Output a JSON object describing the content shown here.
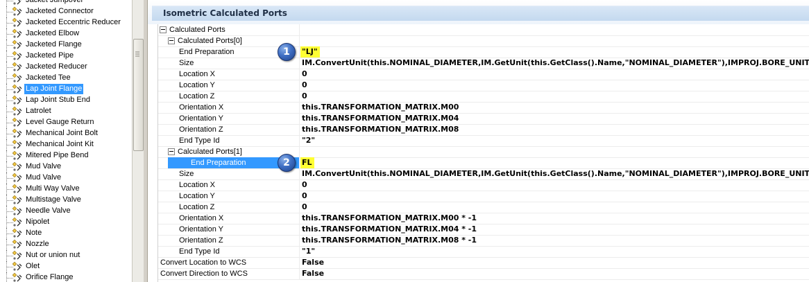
{
  "tree": {
    "items": [
      {
        "label": "Jacket Jumpover"
      },
      {
        "label": "Jacketed Connector"
      },
      {
        "label": "Jacketed Eccentric Reducer"
      },
      {
        "label": "Jacketed Elbow"
      },
      {
        "label": "Jacketed Flange"
      },
      {
        "label": "Jacketed Pipe"
      },
      {
        "label": "Jacketed Reducer"
      },
      {
        "label": "Jacketed Tee"
      },
      {
        "label": "Lap Joint Flange",
        "selected": true
      },
      {
        "label": "Lap Joint Stub End"
      },
      {
        "label": "Latrolet"
      },
      {
        "label": "Level Gauge Return"
      },
      {
        "label": "Mechanical Joint Bolt"
      },
      {
        "label": "Mechanical Joint Kit"
      },
      {
        "label": "Mitered Pipe Bend"
      },
      {
        "label": "Mud Valve"
      },
      {
        "label": "Mud Valve"
      },
      {
        "label": "Multi Way Valve"
      },
      {
        "label": "Multistage Valve"
      },
      {
        "label": "Needle Valve"
      },
      {
        "label": "Nipolet"
      },
      {
        "label": "Note"
      },
      {
        "label": "Nozzle"
      },
      {
        "label": "Nut or union nut"
      },
      {
        "label": "Olet"
      },
      {
        "label": "Orifice Flange"
      }
    ],
    "item_icon": "component-node-icon"
  },
  "panel": {
    "title": "Isometric Calculated Ports"
  },
  "grid": {
    "rows": [
      {
        "name": "Calculated Ports",
        "value": "",
        "level": 0,
        "expander": true
      },
      {
        "name": "Calculated Ports[0]",
        "value": "",
        "level": 1,
        "expander": true
      },
      {
        "name": "End Preparation",
        "value": "\"LJ\"",
        "level": 2,
        "highlight_value": true,
        "callout": "1"
      },
      {
        "name": "Size",
        "value": "IM.ConvertUnit(this.NOMINAL_DIAMETER,IM.GetUnit(this.GetClass().Name,\"NOMINAL_DIAMETER\"),IMPROJ.BORE_UNIT)",
        "level": 2
      },
      {
        "name": "Location X",
        "value": "0",
        "level": 2
      },
      {
        "name": "Location Y",
        "value": "0",
        "level": 2
      },
      {
        "name": "Location Z",
        "value": "0",
        "level": 2
      },
      {
        "name": "Orientation X",
        "value": "this.TRANSFORMATION_MATRIX.M00",
        "level": 2
      },
      {
        "name": "Orientation Y",
        "value": "this.TRANSFORMATION_MATRIX.M04",
        "level": 2
      },
      {
        "name": "Orientation Z",
        "value": "this.TRANSFORMATION_MATRIX.M08",
        "level": 2
      },
      {
        "name": "End Type Id",
        "value": "\"2\"",
        "level": 2
      },
      {
        "name": "Calculated Ports[1]",
        "value": "",
        "level": 1,
        "expander": true
      },
      {
        "name": "End Preparation",
        "value": "FL",
        "level": 2,
        "highlight_name": true,
        "highlight_value": true,
        "callout": "2"
      },
      {
        "name": "Size",
        "value": "IM.ConvertUnit(this.NOMINAL_DIAMETER,IM.GetUnit(this.GetClass().Name,\"NOMINAL_DIAMETER\"),IMPROJ.BORE_UNIT)",
        "level": 2
      },
      {
        "name": "Location X",
        "value": "0",
        "level": 2
      },
      {
        "name": "Location Y",
        "value": "0",
        "level": 2
      },
      {
        "name": "Location Z",
        "value": "0",
        "level": 2
      },
      {
        "name": "Orientation X",
        "value": "this.TRANSFORMATION_MATRIX.M00 * -1",
        "level": 2
      },
      {
        "name": "Orientation Y",
        "value": "this.TRANSFORMATION_MATRIX.M04 * -1",
        "level": 2
      },
      {
        "name": "Orientation Z",
        "value": "this.TRANSFORMATION_MATRIX.M08 * -1",
        "level": 2
      },
      {
        "name": "End Type Id",
        "value": "\"1\"",
        "level": 2
      },
      {
        "name": "Convert Location to WCS",
        "value": "False",
        "level": 0
      },
      {
        "name": "Convert Direction to WCS",
        "value": "False",
        "level": 0
      }
    ]
  },
  "colors": {
    "selection": "#3399ff",
    "value_highlight": "#ffff33",
    "callout": "#3f6fc4"
  }
}
